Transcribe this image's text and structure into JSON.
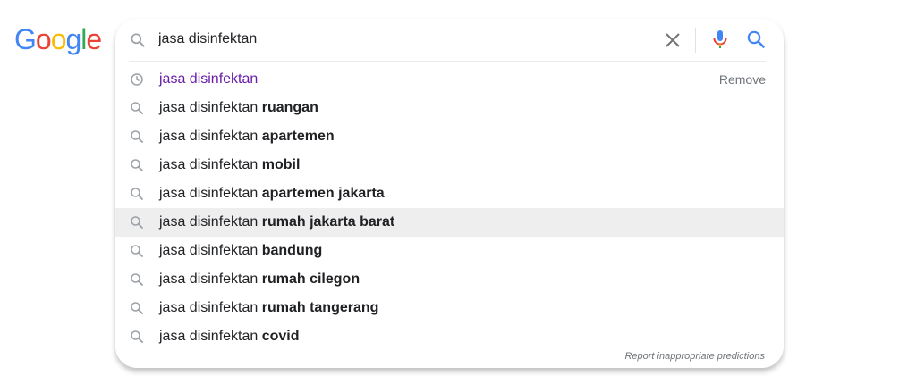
{
  "logo": {
    "text": "Google",
    "letters": [
      "G",
      "o",
      "o",
      "g",
      "l",
      "e"
    ],
    "colors": [
      "#4285f4",
      "#ea4335",
      "#fbbc05",
      "#4285f4",
      "#34a853",
      "#ea4335"
    ]
  },
  "search": {
    "query": "jasa disinfektan",
    "icons": {
      "leading": "search-icon",
      "clear": "close-icon",
      "voice": "microphone-icon",
      "submit": "search-icon"
    }
  },
  "suggestions": [
    {
      "type": "history",
      "base": "jasa disinfektan",
      "suffix": "",
      "action": "Remove",
      "icon": "history-clock-icon"
    },
    {
      "type": "query",
      "base": "jasa disinfektan ",
      "suffix": "ruangan",
      "icon": "search-icon"
    },
    {
      "type": "query",
      "base": "jasa disinfektan ",
      "suffix": "apartemen",
      "icon": "search-icon"
    },
    {
      "type": "query",
      "base": "jasa disinfektan ",
      "suffix": "mobil",
      "icon": "search-icon"
    },
    {
      "type": "query",
      "base": "jasa disinfektan ",
      "suffix": "apartemen jakarta",
      "icon": "search-icon"
    },
    {
      "type": "query",
      "base": "jasa disinfektan ",
      "suffix": "rumah jakarta barat",
      "icon": "search-icon",
      "highlighted": true
    },
    {
      "type": "query",
      "base": "jasa disinfektan ",
      "suffix": "bandung",
      "icon": "search-icon"
    },
    {
      "type": "query",
      "base": "jasa disinfektan ",
      "suffix": "rumah cilegon",
      "icon": "search-icon"
    },
    {
      "type": "query",
      "base": "jasa disinfektan ",
      "suffix": "rumah tangerang",
      "icon": "search-icon"
    },
    {
      "type": "query",
      "base": "jasa disinfektan ",
      "suffix": "covid",
      "icon": "search-icon"
    }
  ],
  "footer": {
    "report_link": "Report inappropriate predictions"
  },
  "colors": {
    "highlight_row": "#eeeeee",
    "history_text": "#681da8",
    "mic_blue": "#4285f4",
    "mic_red": "#ea4335",
    "mic_yellow": "#fbbc05",
    "mic_green": "#34a853"
  }
}
